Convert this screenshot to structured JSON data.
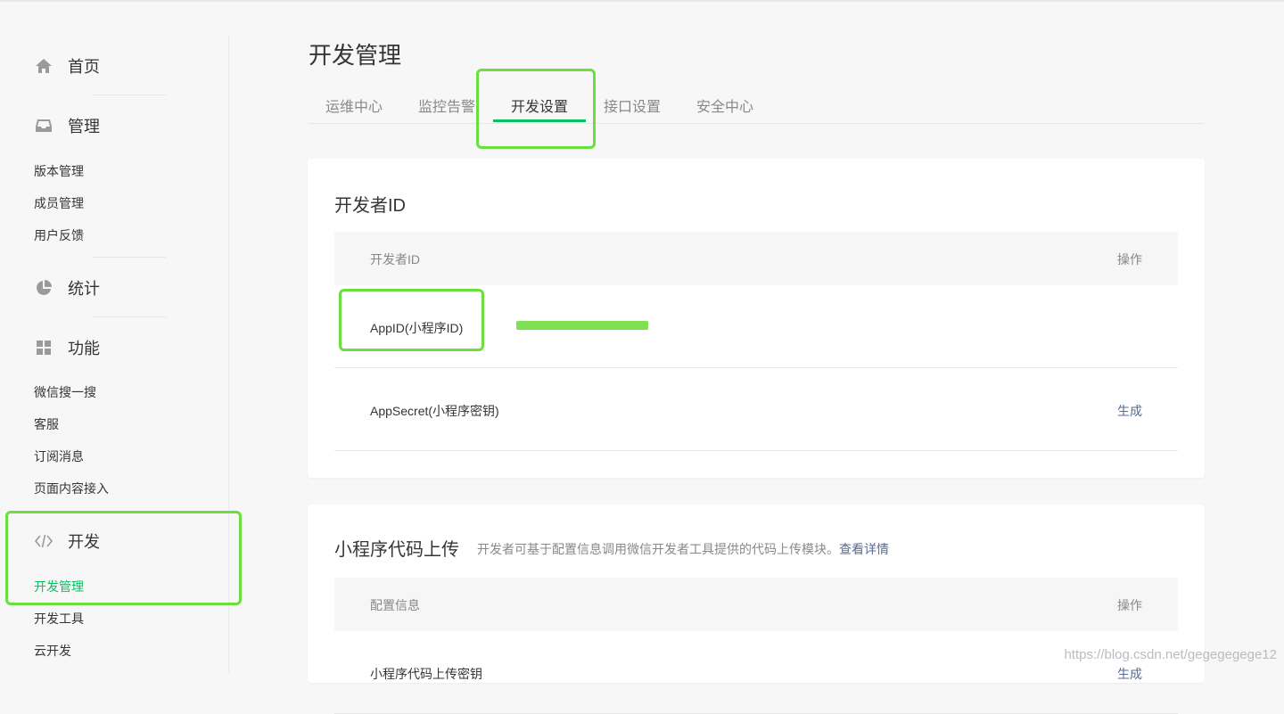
{
  "sidebar": {
    "home": {
      "label": "首页",
      "icon": "home-icon"
    },
    "manage": {
      "label": "管理",
      "icon": "inbox-icon",
      "items": [
        "版本管理",
        "成员管理",
        "用户反馈"
      ]
    },
    "stats": {
      "label": "统计",
      "icon": "pie-chart-icon"
    },
    "features": {
      "label": "功能",
      "icon": "grid-icon",
      "items": [
        "微信搜一搜",
        "客服",
        "订阅消息",
        "页面内容接入"
      ]
    },
    "dev": {
      "label": "开发",
      "icon": "code-icon",
      "items": [
        "开发管理",
        "开发工具",
        "云开发"
      ],
      "active": "开发管理"
    }
  },
  "page": {
    "title": "开发管理"
  },
  "tabs": [
    {
      "label": "运维中心"
    },
    {
      "label": "监控告警"
    },
    {
      "label": "开发设置",
      "active": true
    },
    {
      "label": "接口设置"
    },
    {
      "label": "安全中心"
    }
  ],
  "dev_id_card": {
    "title": "开发者ID",
    "header": {
      "col1": "开发者ID",
      "col2": "操作"
    },
    "rows": [
      {
        "name": "AppID(小程序ID)",
        "value": "",
        "action": ""
      },
      {
        "name": "AppSecret(小程序密钥)",
        "value": "",
        "action": "生成"
      }
    ]
  },
  "upload_card": {
    "title": "小程序代码上传",
    "desc": "开发者可基于配置信息调用微信开发者工具提供的代码上传模块。",
    "desc_link": "查看详情",
    "header": {
      "col1": "配置信息",
      "col2": "操作"
    },
    "rows": [
      {
        "name": "小程序代码上传密钥",
        "action": "生成"
      }
    ]
  },
  "watermark": "https://blog.csdn.net/gegegegege12",
  "colors": {
    "accent": "#07c160",
    "link": "#576b95",
    "highlight": "#6bdf3e"
  }
}
